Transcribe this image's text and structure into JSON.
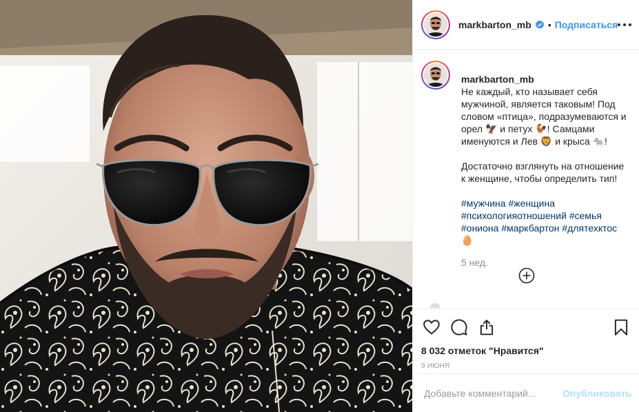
{
  "post": {
    "photo": {
      "alt": ""
    },
    "header": {
      "username": "markbarton_mb",
      "separator": "•",
      "follow_label": "Подписаться",
      "verified_icon": "verified-badge-icon",
      "more_icon": "more-options-icon"
    },
    "caption": {
      "username": "markbarton_mb",
      "paragraph1": "Не каждый, кто называет себя мужчиной, является таковым! Под словом «птица», подразумеваются и орел 🦅 и петух 🐓! Самцами именуются и Лев 🦁 и крыса 🐀!",
      "paragraph2": "Достаточно взглянуть на отношение к женщине, чтобы определить тип!",
      "hashtags": [
        "#мужчина",
        "#женщина",
        "#психологияотношений",
        "#семья",
        "#ониона",
        "#маркбартон",
        "#длятехктос🥚"
      ]
    },
    "time_ago": "5 нед.",
    "actions": {
      "like_icon": "heart-icon",
      "comment_icon": "comment-bubble-icon",
      "share_icon": "share-icon",
      "save_icon": "bookmark-icon",
      "load_more_icon": "plus-circle-icon"
    },
    "likes_text": "8 032 отметок \"Нравится\"",
    "date": "9 июня",
    "comment_form": {
      "placeholder": "Добавьте комментарий...",
      "publish_label": "Опубликовать"
    },
    "colors": {
      "link_blue": "#3897f0",
      "hashtag": "#003569",
      "publish_disabled": "#b2dffc",
      "muted": "#8e8e8e"
    }
  }
}
